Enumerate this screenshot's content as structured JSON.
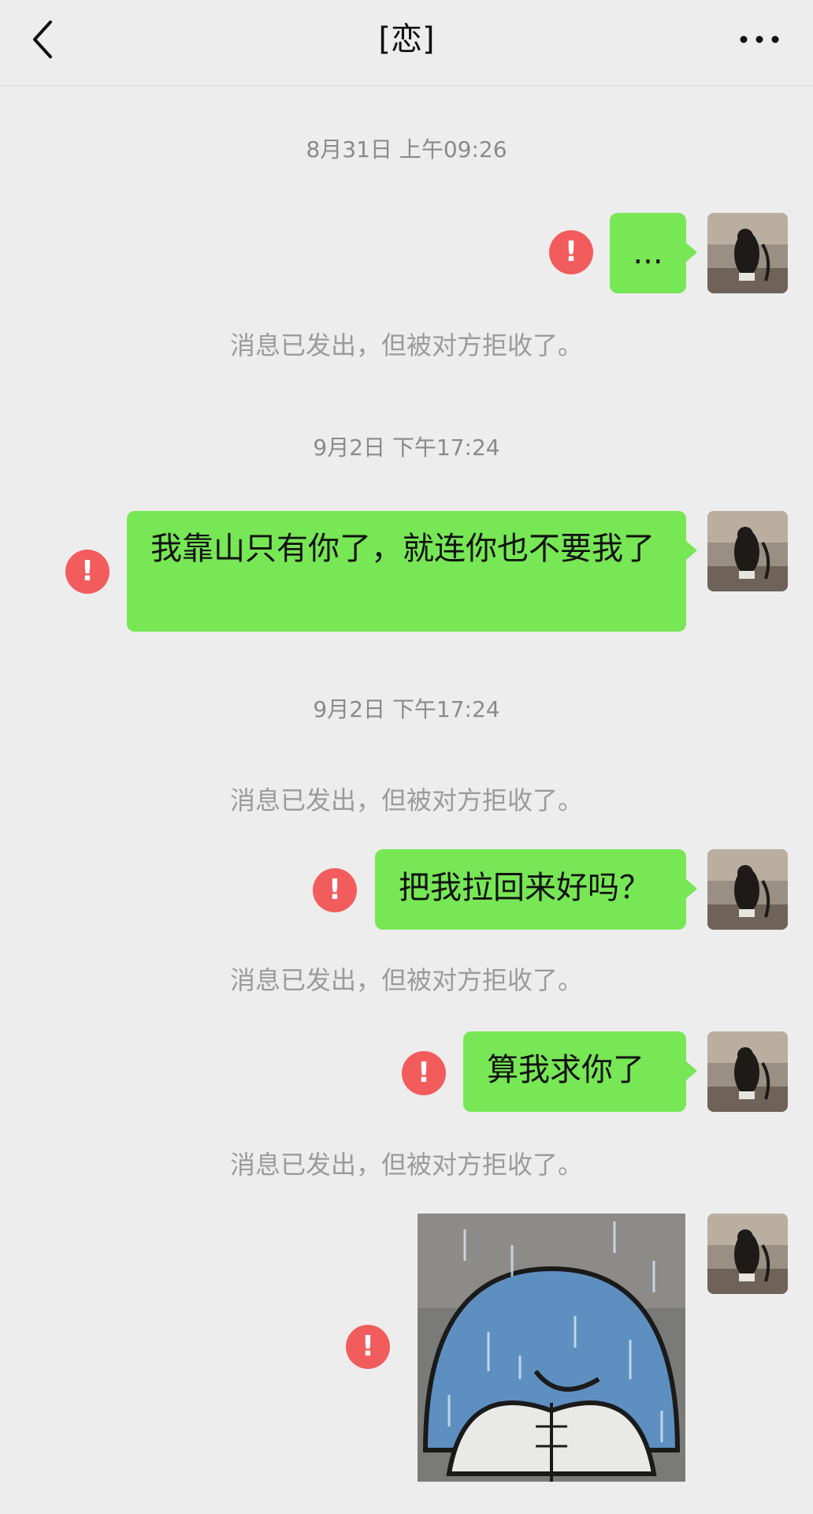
{
  "header": {
    "title": "[恋]"
  },
  "timestamps": [
    "8月31日 上午09:26",
    "9月2日 下午17:24",
    "9月2日 下午17:24"
  ],
  "system_notice": "消息已发出，但被对方拒收了。",
  "messages": [
    {
      "text": "..."
    },
    {
      "text": "我靠山只有你了，就连你也不要我了"
    },
    {
      "text": "把我拉回来好吗？"
    },
    {
      "text": "算我求你了"
    }
  ],
  "error_mark": "!",
  "icons": {
    "back": "chevron-left-icon",
    "more": "more-dots-icon",
    "error": "error-icon"
  },
  "colors": {
    "bubble": "#77e755",
    "error": "#f25c5c",
    "background": "#ededed"
  }
}
